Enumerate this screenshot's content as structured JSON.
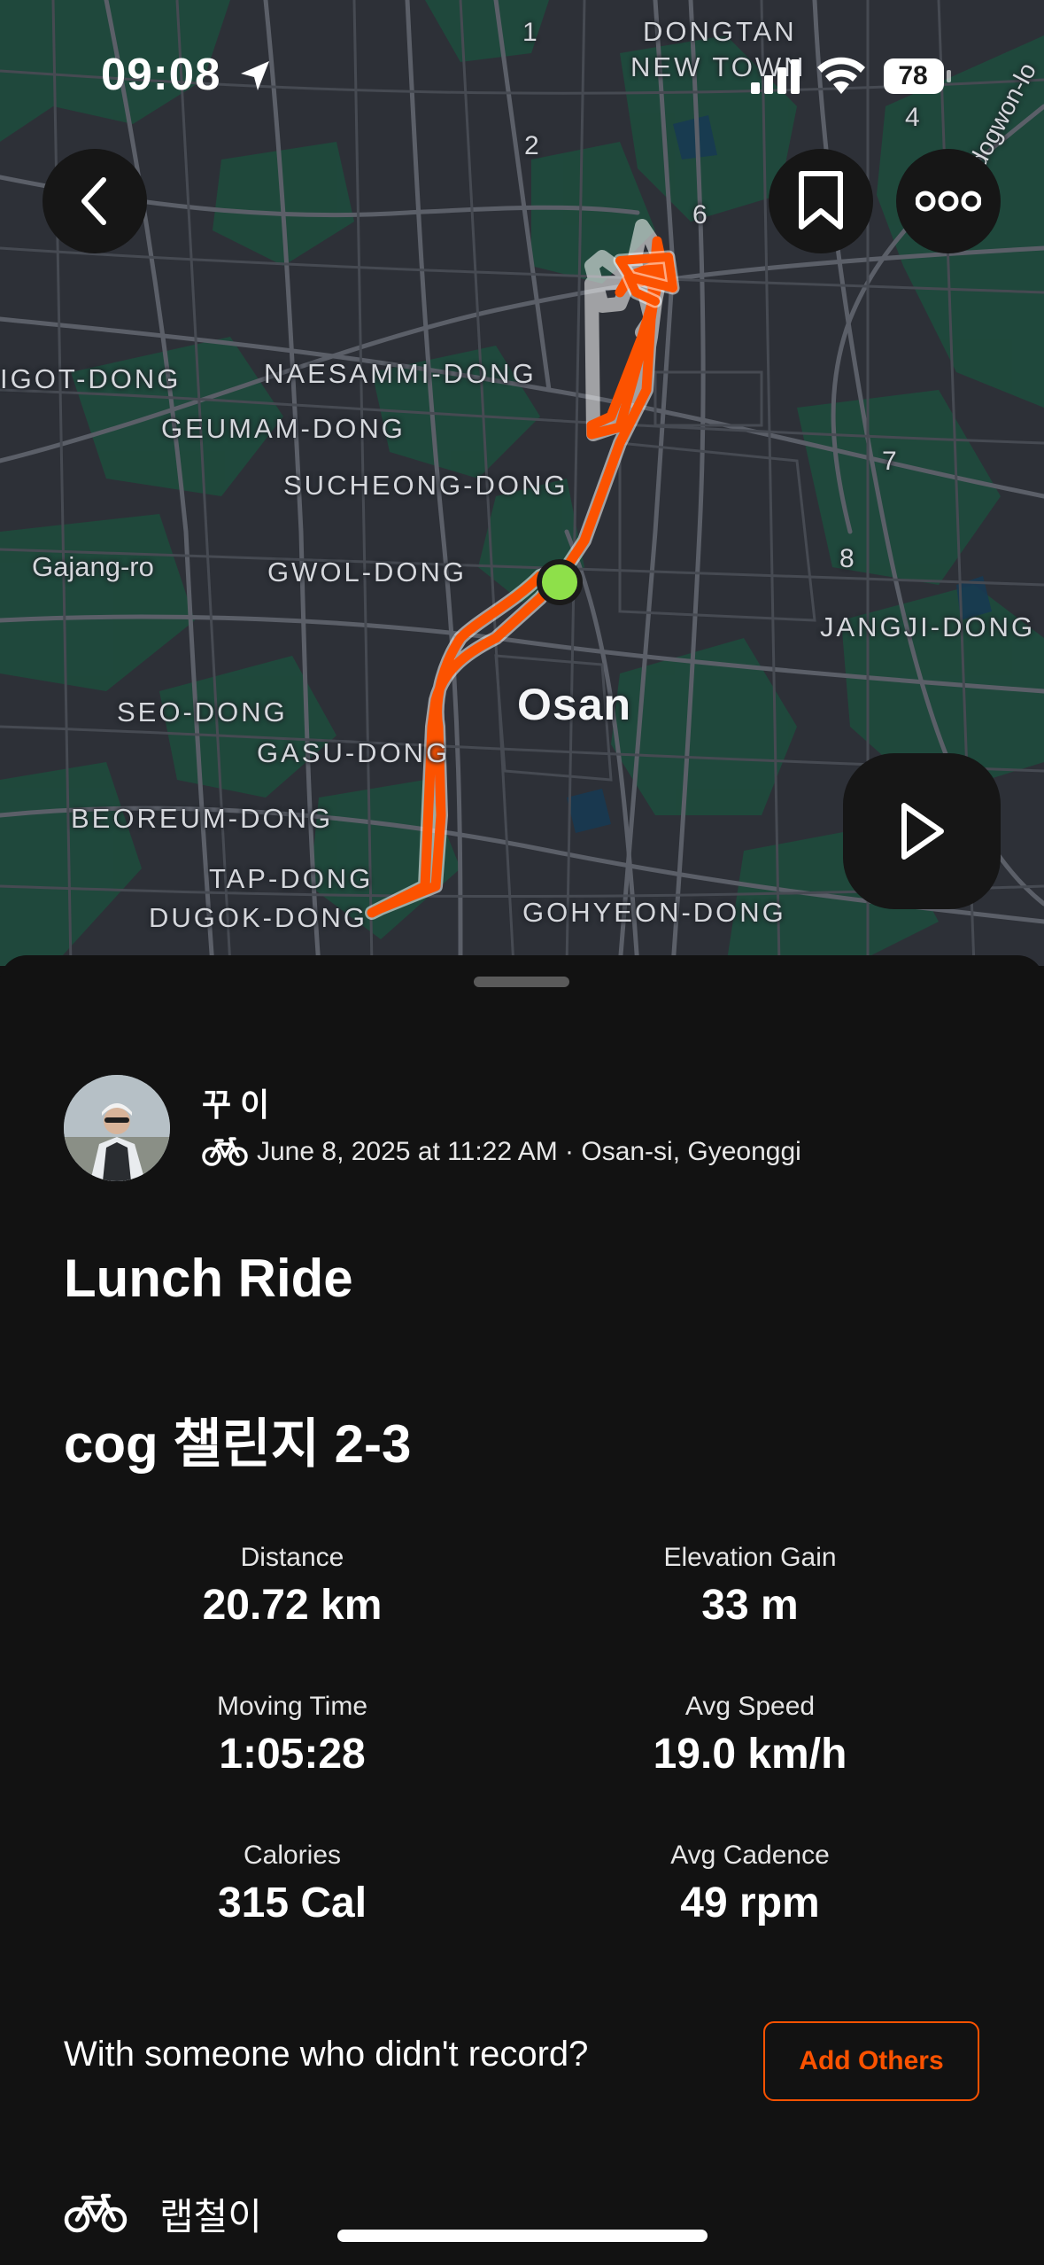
{
  "status_bar": {
    "time": "09:08",
    "battery": "78"
  },
  "map": {
    "labels": {
      "dongtan": "DONGTAN",
      "new_town": "NEW TOWN",
      "gigot_dong": "IGOT-DONG",
      "naesammi_dong": "NAESAMMI-DONG",
      "geumam_dong": "GEUMAM-DONG",
      "sucheong_dong": "SUCHEONG-DONG",
      "gajang_ro": "Gajang-ro",
      "gwol_dong": "GWOL-DONG",
      "jangji_dong": "JANGJI-DONG",
      "osan": "Osan",
      "seo_dong": "SEO-DONG",
      "gasu_dong": "GASU-DONG",
      "beoreum_dong": "BEOREUM-DONG",
      "tap_dong": "TAP-DONG",
      "dugok_dong": "DUGOK-DONG",
      "gohyeon_dong": "GOHYEON-DONG",
      "suwon_road": "Sudogwon-lo",
      "n1": "1",
      "n2": "2",
      "n4": "4",
      "n6": "6",
      "n7": "7",
      "n8": "8"
    },
    "route_color": "#fc5200",
    "start_marker_color": "#8ee04a"
  },
  "buttons": {
    "back_icon": "chevron-left-icon",
    "bookmark_icon": "bookmark-icon",
    "more_icon": "more-horizontal-icon",
    "play_icon": "play-icon"
  },
  "activity": {
    "athlete_name": "꾸 이",
    "meta": "June 8, 2025 at 11:22 AM · Osan-si, Gyeonggi",
    "title": "Lunch Ride",
    "description": "cog 챌린지 2-3",
    "stats": {
      "distance": {
        "label": "Distance",
        "value": "20.72 km"
      },
      "elevation": {
        "label": "Elevation Gain",
        "value": "33 m"
      },
      "moving_time": {
        "label": "Moving Time",
        "value": "1:05:28"
      },
      "avg_speed": {
        "label": "Avg Speed",
        "value": "19.0 km/h"
      },
      "calories": {
        "label": "Calories",
        "value": "315 Cal"
      },
      "avg_cadence": {
        "label": "Avg Cadence",
        "value": "49 rpm"
      }
    },
    "with_someone": "With someone who didn't record?",
    "add_others_label": "Add Others",
    "gear_name": "랩철이"
  },
  "colors": {
    "accent": "#fc5200",
    "background": "#121212"
  }
}
